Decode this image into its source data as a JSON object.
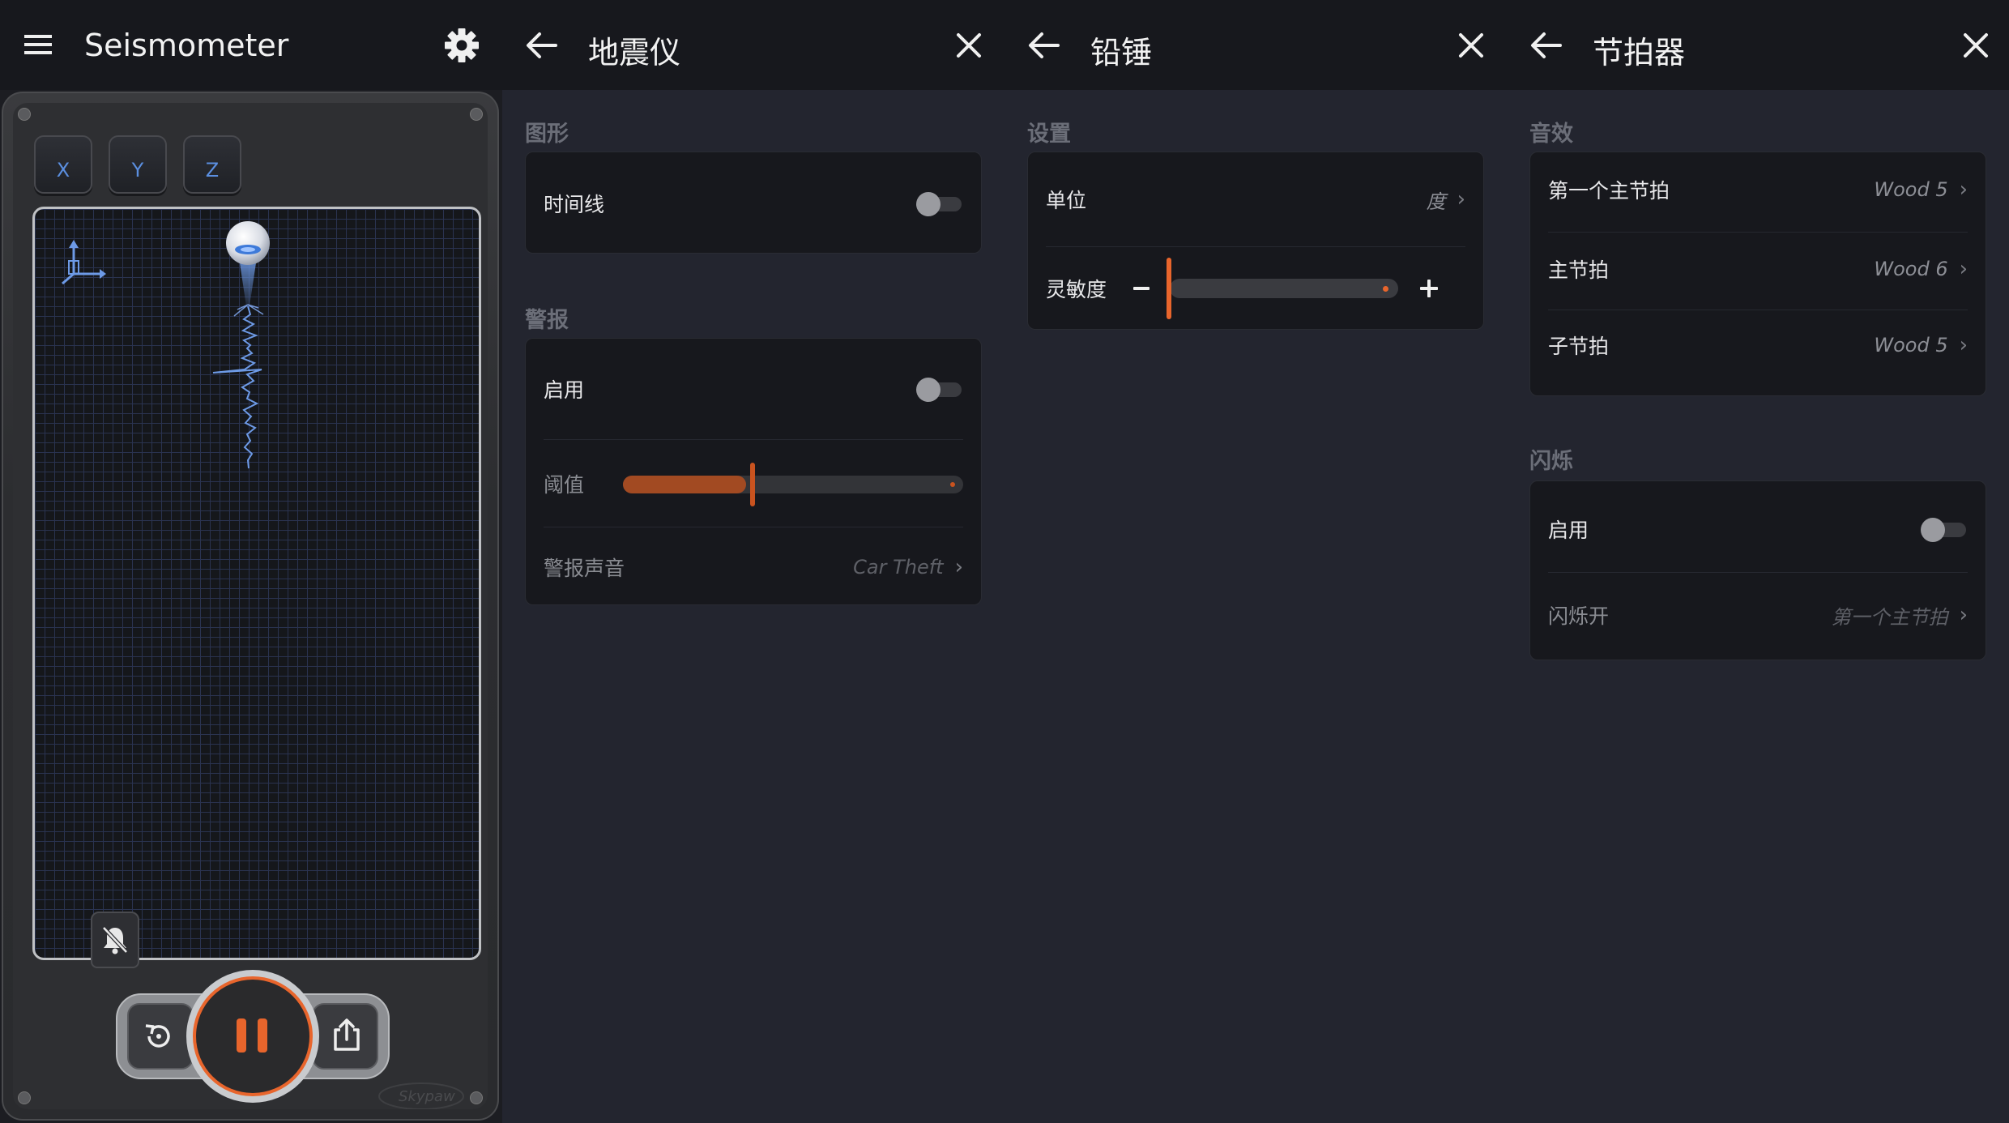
{
  "seismometer": {
    "title": "Seismometer",
    "axes": [
      "X",
      "Y",
      "Z"
    ],
    "icons": {
      "menu": "hamburger-menu-icon",
      "settings": "gear-icon",
      "coord": "axes-icon",
      "mute": "bell-off-icon",
      "reset": "reset-icon",
      "pause": "pause-icon",
      "share": "share-icon"
    },
    "brand": "Skypaw"
  },
  "earthquake_panel": {
    "title": "地震仪",
    "graphics": {
      "section": "图形",
      "timeline_label": "时间线",
      "timeline_on": false
    },
    "alarm": {
      "section": "警报",
      "enable_label": "启用",
      "enable_on": false,
      "threshold_label": "阈值",
      "threshold_level": 0.38,
      "sound_label": "警报声音",
      "sound_value": "Car Theft"
    }
  },
  "plumb_panel": {
    "title": "铅锤",
    "settings": {
      "section": "设置",
      "unit_label": "单位",
      "unit_value": "度",
      "sensitivity_label": "灵敏度",
      "sensitivity_level": 0.0
    }
  },
  "metronome_panel": {
    "title": "节拍器",
    "sound": {
      "section": "音效",
      "first_beat_label": "第一个主节拍",
      "first_beat_value": "Wood 5",
      "main_beat_label": "主节拍",
      "main_beat_value": "Wood 6",
      "sub_beat_label": "子节拍",
      "sub_beat_value": "Wood 5"
    },
    "flash": {
      "section": "闪烁",
      "enable_label": "启用",
      "enable_on": false,
      "flash_on_label": "闪烁开",
      "flash_on_value": "第一个主节拍"
    }
  },
  "colors": {
    "accent": "#e8652c",
    "topbar": "#17181d",
    "background": "#23252f",
    "card": "#17181d",
    "trace": "#6d9ae6"
  }
}
